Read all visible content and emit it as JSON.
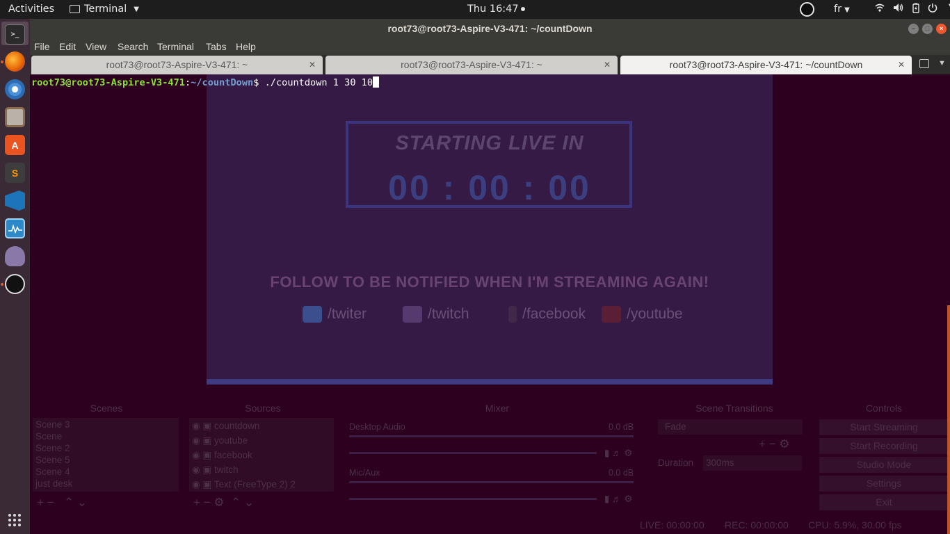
{
  "topbar": {
    "activities": "Activities",
    "app_name": "Terminal",
    "clock": "Thu 16:47",
    "language": "fr",
    "sys_icons": [
      "wifi-icon",
      "volume-icon",
      "battery-icon",
      "power-icon"
    ]
  },
  "dock": {
    "items": [
      {
        "name": "terminal",
        "label": ">_",
        "color": "#2b2b2b"
      },
      {
        "name": "firefox",
        "label": "",
        "color": "#e66000"
      },
      {
        "name": "chromium",
        "label": "",
        "color": "#4a90d9"
      },
      {
        "name": "files",
        "label": "",
        "color": "#b9b2a8"
      },
      {
        "name": "software",
        "label": "A",
        "color": "#e95420"
      },
      {
        "name": "sublime",
        "label": "S",
        "color": "#3d3d3d"
      },
      {
        "name": "vscode",
        "label": "",
        "color": "#1e74b8"
      },
      {
        "name": "monitor",
        "label": "",
        "color": "#2e89c8"
      },
      {
        "name": "pidgin",
        "label": "",
        "color": "#8a78a8"
      },
      {
        "name": "obs",
        "label": "",
        "color": "#111111"
      }
    ]
  },
  "window": {
    "title": "root73@root73-Aspire-V3-471: ~/countDown",
    "menu": [
      "File",
      "Edit",
      "View",
      "Search",
      "Terminal",
      "Tabs",
      "Help"
    ],
    "tabs": [
      {
        "label": "root73@root73-Aspire-V3-471: ~"
      },
      {
        "label": "root73@root73-Aspire-V3-471: ~"
      },
      {
        "label": "root73@root73-Aspire-V3-471: ~/countDown"
      }
    ]
  },
  "terminal": {
    "user_host": "root73@root73-Aspire-V3-471",
    "sep": ":",
    "path": "~/countDown",
    "dollar": "$ ",
    "command": "./countdown 1 30 10"
  },
  "obs": {
    "preview": {
      "heading": "STARTING LIVE IN",
      "timer": "00 : 00 : 00",
      "follow": "FOLLOW TO BE NOTIFIED WHEN I'M STREAMING AGAIN!",
      "social": [
        "/twiter",
        "/twitch",
        "/facebook",
        "/youtube"
      ]
    },
    "headers": [
      "Scenes",
      "Sources",
      "Mixer",
      "Scene Transitions",
      "Controls"
    ],
    "scenes": [
      "Scene 3",
      "Scene",
      "Scene 2",
      "Scene 5",
      "Scene 4",
      "just desk"
    ],
    "sources": [
      "countdown",
      "youtube",
      "facebook",
      "twitch",
      "Text (FreeType 2) 2"
    ],
    "mixer": [
      {
        "label": "Desktop Audio",
        "db": "0.0 dB"
      },
      {
        "label": "Mic/Aux",
        "db": "0.0 dB"
      }
    ],
    "transition": {
      "selected": "Fade",
      "duration_label": "Duration",
      "duration_value": "300ms"
    },
    "controls": [
      "Start Streaming",
      "Start Recording",
      "Studio Mode",
      "Settings",
      "Exit"
    ],
    "status": {
      "live": "LIVE: 00:00:00",
      "rec": "REC: 00:00:00",
      "cpu": "CPU: 5.9%, 30.00 fps"
    }
  }
}
